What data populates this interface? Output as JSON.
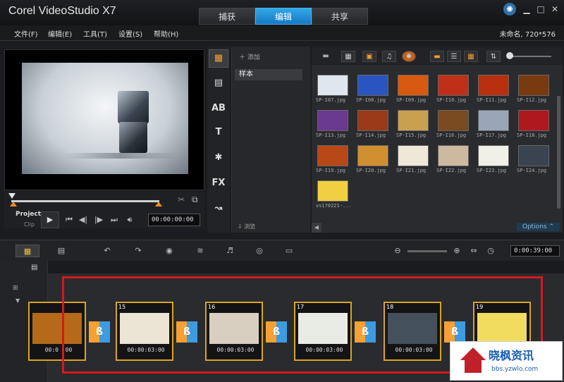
{
  "app": {
    "title": "Corel VideoStudio X7",
    "project_info": "未命名, 720*576"
  },
  "tabs": [
    {
      "label": "捕获"
    },
    {
      "label": "编辑"
    },
    {
      "label": "共享"
    }
  ],
  "menu": [
    {
      "label": "文件(F)"
    },
    {
      "label": "编辑(E)"
    },
    {
      "label": "工具(T)"
    },
    {
      "label": "设置(S)"
    },
    {
      "label": "帮助(H)"
    }
  ],
  "player": {
    "project_label": "Project",
    "clip_label": "Clip",
    "timecode": "00:00:00:00"
  },
  "library": {
    "add_label": "添加",
    "folder": "样本",
    "browse_label": "浏览",
    "options_label": "Options",
    "thumbs": [
      {
        "name": "SP-I07.jpg",
        "color": "#dfe6ee"
      },
      {
        "name": "SP-I08.jpg",
        "color": "#2a55c0"
      },
      {
        "name": "SP-I09.jpg",
        "color": "#d85a10"
      },
      {
        "name": "SP-I10.jpg",
        "color": "#c03018"
      },
      {
        "name": "SP-I11.jpg",
        "color": "#b83010"
      },
      {
        "name": "SP-I12.jpg",
        "color": "#7a3a10"
      },
      {
        "name": "SP-I13.jpg",
        "color": "#6a3a90"
      },
      {
        "name": "SP-I14.jpg",
        "color": "#9a3a18"
      },
      {
        "name": "SP-I15.jpg",
        "color": "#c8a050"
      },
      {
        "name": "SP-I16.jpg",
        "color": "#7a4a20"
      },
      {
        "name": "SP-I17.jpg",
        "color": "#9aa6b8"
      },
      {
        "name": "SP-I18.jpg",
        "color": "#b01820"
      },
      {
        "name": "SP-I19.jpg",
        "color": "#b84818"
      },
      {
        "name": "SP-I20.jpg",
        "color": "#d09030"
      },
      {
        "name": "SP-I21.jpg",
        "color": "#eee8d8"
      },
      {
        "name": "SP-I22.jpg",
        "color": "#cdb8a0"
      },
      {
        "name": "SP-I23.jpg",
        "color": "#f0f0e8"
      },
      {
        "name": "SP-I24.jpg",
        "color": "#3a4450"
      },
      {
        "name": "vs170221-...",
        "color": "#f0d040"
      }
    ]
  },
  "timeline": {
    "total_time": "0:00:39:00",
    "clips": [
      {
        "num": "",
        "time": "00:0 :00",
        "color": "#b46a18"
      },
      {
        "num": "15",
        "time": "00:00:03:00",
        "color": "#ece4d4"
      },
      {
        "num": "16",
        "time": "00:00:03:00",
        "color": "#d8cfc0"
      },
      {
        "num": "17",
        "time": "00:00:03:00",
        "color": "#e8ece4"
      },
      {
        "num": "18",
        "time": "00:00:03:00",
        "color": "#44505c"
      },
      {
        "num": "19",
        "time": "",
        "color": "#f2dc60"
      }
    ]
  },
  "watermark": {
    "title": "晓枫资讯",
    "url": "bbs.yzwlo.com"
  }
}
